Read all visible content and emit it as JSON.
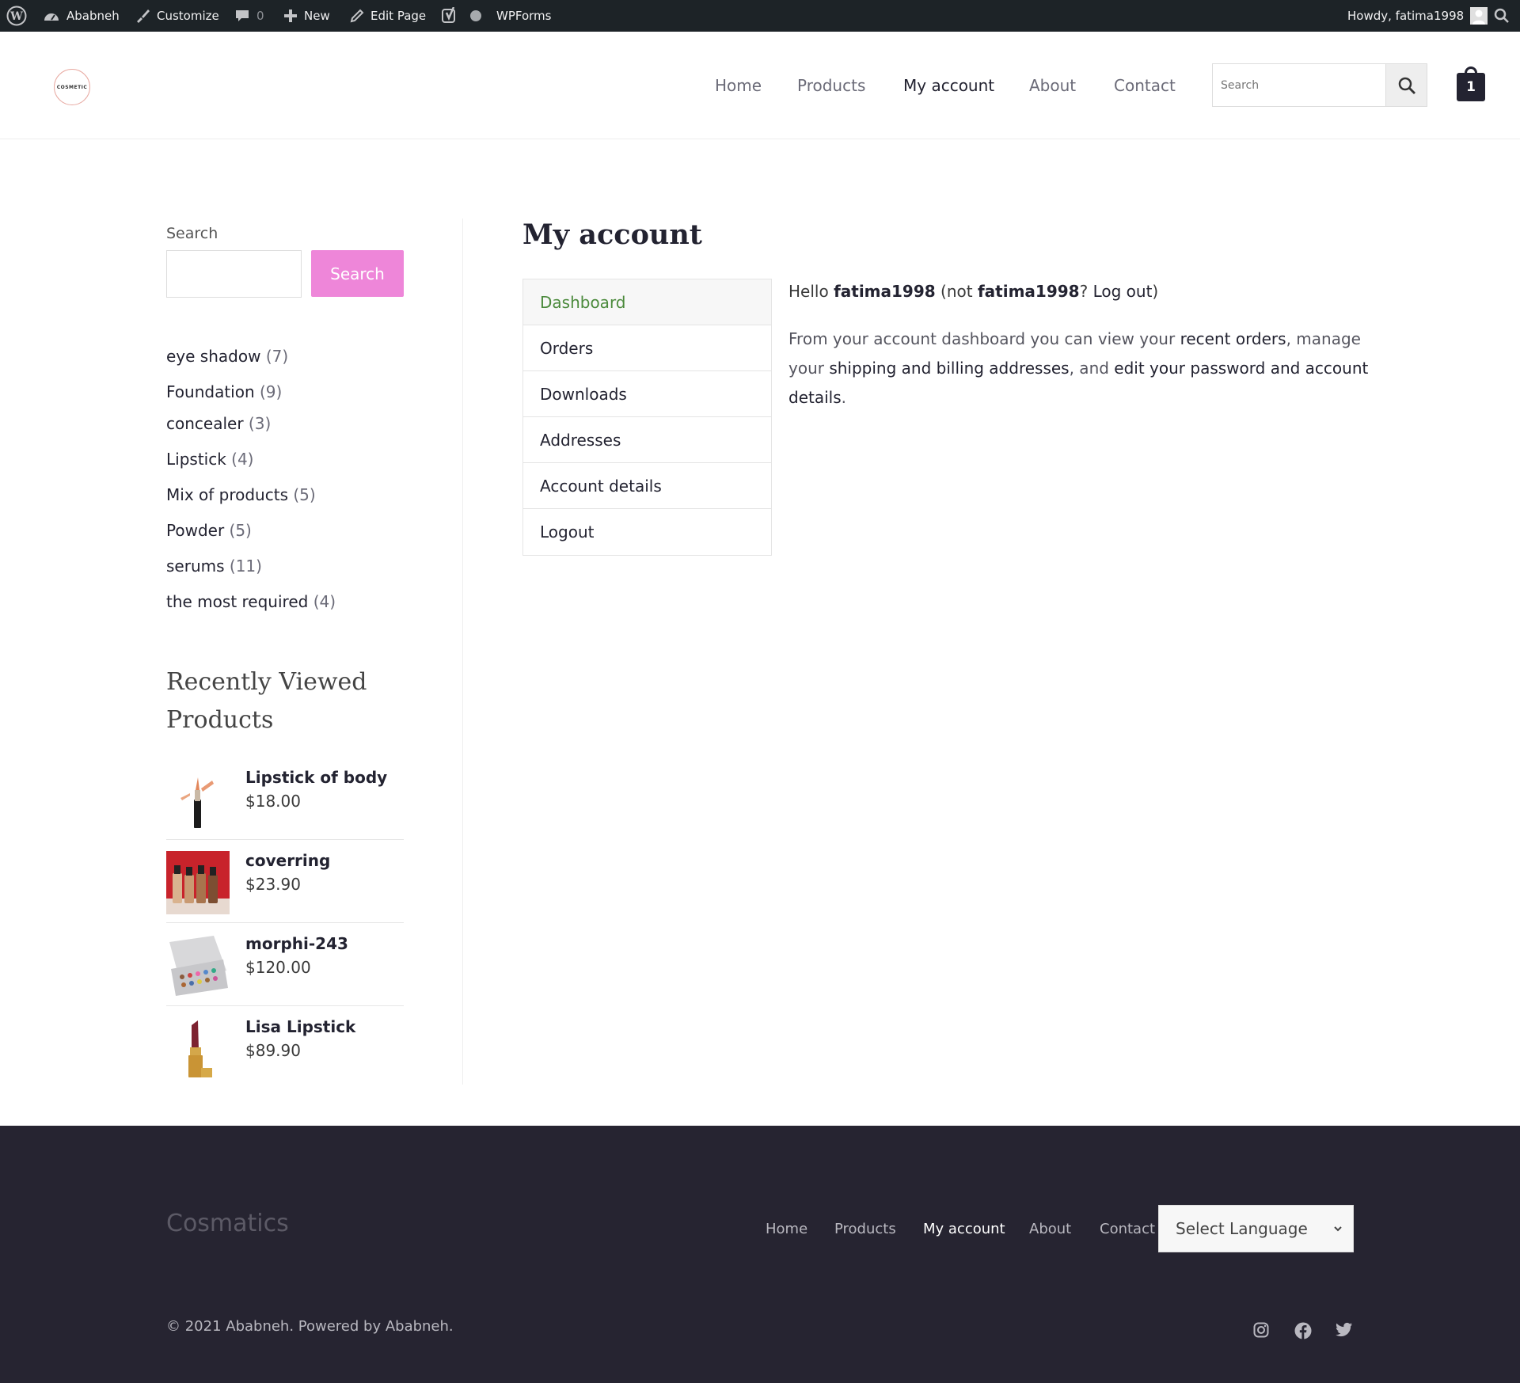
{
  "admin_bar": {
    "site_name": "Ababneh",
    "customize": "Customize",
    "comments_count": "0",
    "new_label": "New",
    "edit_page": "Edit Page",
    "wpforms": "WPForms",
    "howdy": "Howdy, fatima1998"
  },
  "header": {
    "logo_text": "COSMETIC",
    "nav": [
      "Home",
      "Products",
      "My account",
      "About",
      "Contact"
    ],
    "active_nav": "My account",
    "search_placeholder": "Search",
    "cart_count": "1"
  },
  "sidebar": {
    "search_label": "Search",
    "search_button": "Search",
    "categories": [
      {
        "name": "eye shadow",
        "count": "(7)"
      },
      {
        "name": "Foundation",
        "count": "(9)"
      },
      {
        "name": "concealer",
        "count": "(3)"
      },
      {
        "name": "Lipstick",
        "count": "(4)"
      },
      {
        "name": "Mix of products",
        "count": "(5)"
      },
      {
        "name": "Powder",
        "count": "(5)"
      },
      {
        "name": "serums",
        "count": "(11)"
      },
      {
        "name": "the most required",
        "count": "(4)"
      }
    ],
    "recently_viewed_title": "Recently Viewed Products",
    "recently_viewed": [
      {
        "name": "Lipstick of body",
        "price": "$18.00"
      },
      {
        "name": "coverring",
        "price": "$23.90"
      },
      {
        "name": "morphi-243",
        "price": "$120.00"
      },
      {
        "name": "Lisa Lipstick",
        "price": "$89.90"
      }
    ]
  },
  "main": {
    "title": "My account",
    "account_nav": [
      "Dashboard",
      "Orders",
      "Downloads",
      "Addresses",
      "Account details",
      "Logout"
    ],
    "active_item": "Dashboard",
    "hello_prefix": "Hello ",
    "username": "fatima1998",
    "hello_not": " (not ",
    "hello_q": "? ",
    "logout_link": "Log out",
    "hello_close": ")",
    "intro_1": "From your account dashboard you can view your ",
    "recent_orders": "recent orders",
    "intro_2": ", manage your ",
    "addresses_link": "shipping and billing addresses",
    "intro_3": ", and ",
    "details_link": "edit your password and account details",
    "intro_4": "."
  },
  "footer": {
    "brand": "Cosmatics",
    "nav": [
      "Home",
      "Products",
      "My account",
      "About",
      "Contact"
    ],
    "active_nav": "My account",
    "language_select": "Select Language",
    "copyright": "© 2021 Ababneh. Powered by Ababneh.",
    "social_icons": [
      "instagram-icon",
      "facebook-icon",
      "twitter-icon"
    ]
  },
  "colors": {
    "admin_bar_bg": "#1d2327",
    "search_button_bg": "#ee86d9",
    "active_account_item": "#4b8a3c",
    "footer_bg": "#262431",
    "heading": "#232331"
  }
}
